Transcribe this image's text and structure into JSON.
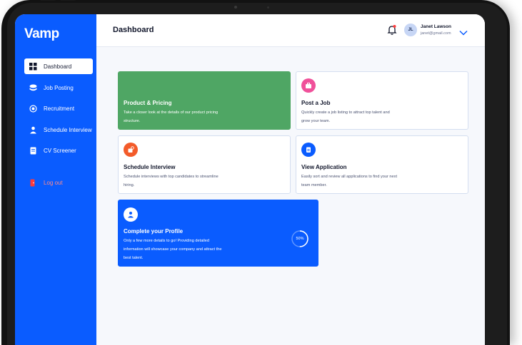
{
  "app": {
    "logo_text": "Vamp"
  },
  "sidebar": {
    "items": [
      {
        "label": "Dashboard",
        "icon": "grid-icon",
        "active": true
      },
      {
        "label": "Job Posting",
        "icon": "stack-icon",
        "active": false
      },
      {
        "label": "Recruitment",
        "icon": "target-icon",
        "active": false
      },
      {
        "label": "Schedule Interview",
        "icon": "person-icon",
        "active": false
      },
      {
        "label": "CV Screener",
        "icon": "document-icon",
        "active": false
      }
    ],
    "logout_label": "Log out"
  },
  "header": {
    "title": "Dashboard",
    "user": {
      "initials": "JL",
      "name": "Janet Lawson",
      "email": "janet@gmail.com"
    }
  },
  "cards": {
    "product_pricing": {
      "title": "Product & Pricing",
      "desc_line1": "Take a closer look at the details of our product pricing",
      "desc_line2": "structure."
    },
    "post_job": {
      "title": "Post a Job",
      "desc_line1": "Quickly create a job listing to attract top talent and",
      "desc_line2": "grow your team.",
      "icon": "briefcase-icon"
    },
    "schedule_interview": {
      "title": "Schedule Interview",
      "desc_line1": "Schedule interviews with top candidates to streamline",
      "desc_line2": "hiring.",
      "icon": "calendar-icon"
    },
    "view_application": {
      "title": "View Application",
      "desc_line1": "Easily sort and review all applications to find your next",
      "desc_line2": "team member.",
      "icon": "clipboard-icon"
    },
    "complete_profile": {
      "title": "Complete your Profile",
      "desc_line1": "Only a few more details to go! Providing detailed",
      "desc_line2": "information will showcase your company and attract the",
      "desc_line3": "best talent.",
      "icon": "user-icon",
      "progress_label": "50%",
      "progress_value": 0.5
    }
  },
  "colors": {
    "brand_blue": "#0a5cff",
    "green": "#4fa664",
    "pink": "#f0509a",
    "orange": "#f35b2a"
  }
}
